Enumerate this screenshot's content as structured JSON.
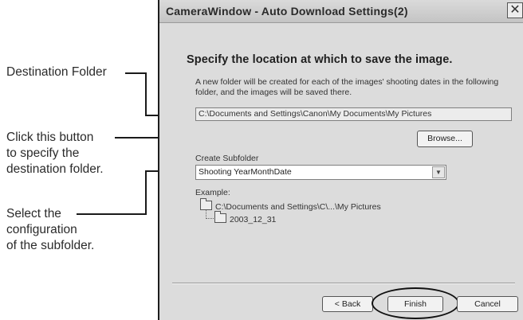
{
  "callouts": {
    "destination": "Destination Folder",
    "browse_line1": "Click this button",
    "browse_line2": "to specify the",
    "browse_line3": "destination folder.",
    "subfolder_line1": "Select the",
    "subfolder_line2": "configuration",
    "subfolder_line3": "of the subfolder."
  },
  "dialog": {
    "title": "CameraWindow - Auto Download Settings(2)",
    "close_glyph": "✕",
    "heading": "Specify the location at which to save the image.",
    "description": "A new folder will be created for each of the images' shooting dates in the following folder, and the images will be saved there.",
    "destination_path": "C:\\Documents and Settings\\Canon\\My Documents\\My Pictures",
    "browse_label": "Browse...",
    "create_subfolder_label": "Create Subfolder",
    "subfolder_value": "Shooting YearMonthDate",
    "dropdown_arrow": "▼",
    "example_label": "Example:",
    "example_parent": "C:\\Documents and Settings\\C\\...\\My Pictures",
    "example_child": "2003_12_31",
    "back_label": "< Back",
    "finish_label": "Finish",
    "cancel_label": "Cancel"
  }
}
